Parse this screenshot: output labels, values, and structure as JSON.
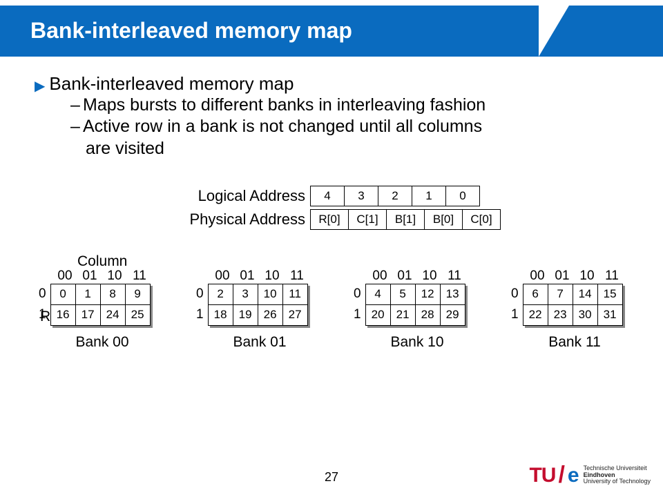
{
  "title": "Bank-interleaved memory map",
  "bullet": "Bank-interleaved memory map",
  "sub1": "Maps bursts to different banks in interleaving fashion",
  "sub2a": "Active row in a bank is not changed until all columns",
  "sub2b": "are visited",
  "addr": {
    "logical_label": "Logical Address",
    "physical_label": "Physical Address",
    "logical": [
      "4",
      "3",
      "2",
      "1",
      "0"
    ],
    "physical": [
      "R[0]",
      "C[1]",
      "B[1]",
      "B[0]",
      "C[0]"
    ]
  },
  "column_label": "Column",
  "row_label": "Row",
  "col_headers": [
    "00",
    "01",
    "10",
    "11"
  ],
  "row_headers": [
    "0",
    "1"
  ],
  "banks": [
    {
      "name": "Bank 00",
      "rows": [
        [
          "0",
          "1",
          "8",
          "9"
        ],
        [
          "16",
          "17",
          "24",
          "25"
        ]
      ]
    },
    {
      "name": "Bank 01",
      "rows": [
        [
          "2",
          "3",
          "10",
          "11"
        ],
        [
          "18",
          "19",
          "26",
          "27"
        ]
      ]
    },
    {
      "name": "Bank 10",
      "rows": [
        [
          "4",
          "5",
          "12",
          "13"
        ],
        [
          "20",
          "21",
          "28",
          "29"
        ]
      ]
    },
    {
      "name": "Bank 11",
      "rows": [
        [
          "6",
          "7",
          "14",
          "15"
        ],
        [
          "22",
          "23",
          "30",
          "31"
        ]
      ]
    }
  ],
  "page_number": "27",
  "footer": {
    "tu": "TU",
    "e": "e",
    "l1": "Technische Universiteit",
    "l2": "Eindhoven",
    "l3": "University of Technology"
  }
}
